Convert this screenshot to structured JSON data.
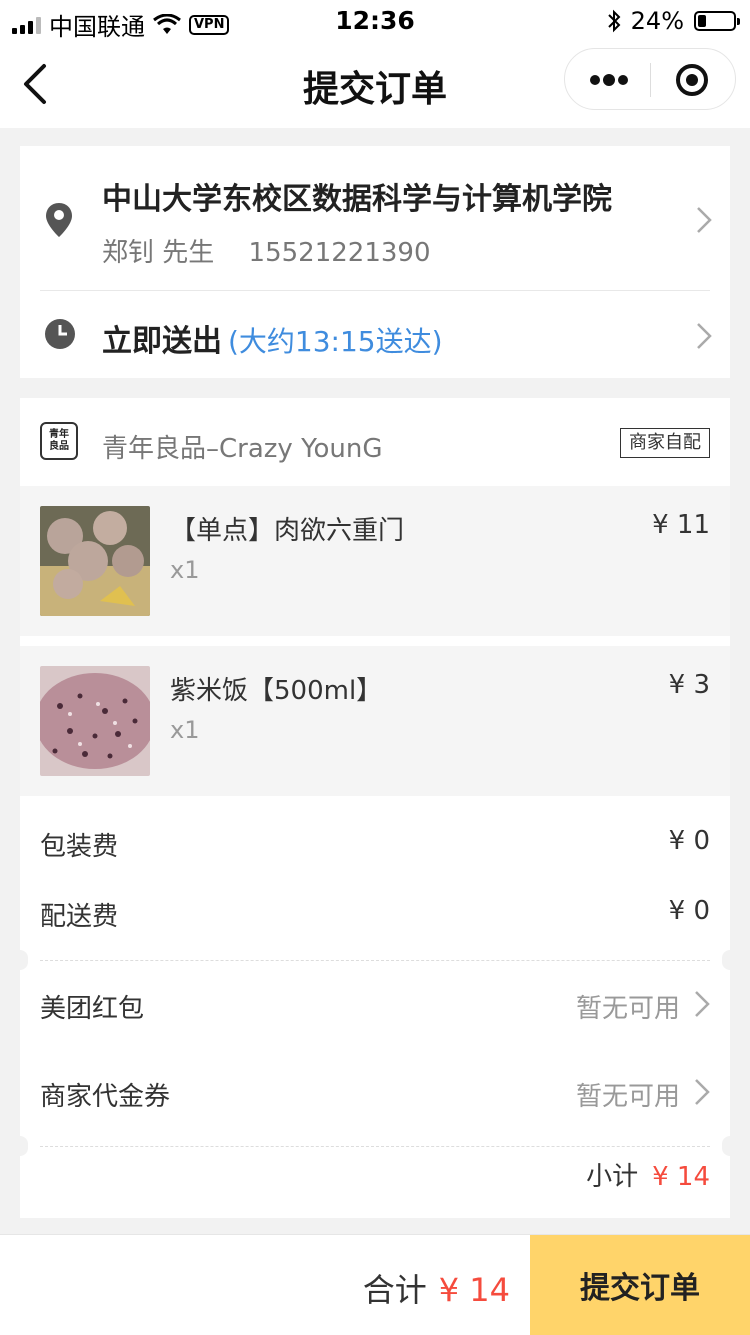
{
  "status_bar": {
    "carrier": "中国联通",
    "vpn": "VPN",
    "time": "12:36",
    "battery": "24%",
    "battery_level": 0.24
  },
  "navbar": {
    "title": "提交订单",
    "icons": [
      "back-arrow-icon",
      "more-dots-icon",
      "target-icon"
    ]
  },
  "address": {
    "title": "中山大学东校区数据科学与计算机学院",
    "contact": "郑钊 先生",
    "phone": "15521221390"
  },
  "delivery": {
    "label": "立即送出",
    "eta": "(大约13:15送达)"
  },
  "shop": {
    "logo_text": "青年良品",
    "name": "青年良品–Crazy YounG",
    "tag": "商家自配"
  },
  "items": [
    {
      "name": "【单点】肉欲六重门",
      "qty": "x1",
      "price": "¥ 11"
    },
    {
      "name": "紫米饭【500ml】",
      "qty": "x1",
      "price": "¥ 3"
    }
  ],
  "fees": {
    "packaging_label": "包装费",
    "packaging_value": "¥ 0",
    "delivery_label": "配送费",
    "delivery_value": "¥ 0",
    "redpacket_label": "美团红包",
    "redpacket_value": "暂无可用",
    "coupon_label": "商家代金券",
    "coupon_value": "暂无可用"
  },
  "subtotal": {
    "label": "小计",
    "amount": "¥ 14"
  },
  "footer": {
    "total_label": "合计",
    "total_amount": "¥ 14",
    "submit": "提交订单"
  },
  "colors": {
    "accent_price": "#f54b3d",
    "submit_bg": "#ffd46a",
    "eta_blue": "#3f8cde"
  }
}
